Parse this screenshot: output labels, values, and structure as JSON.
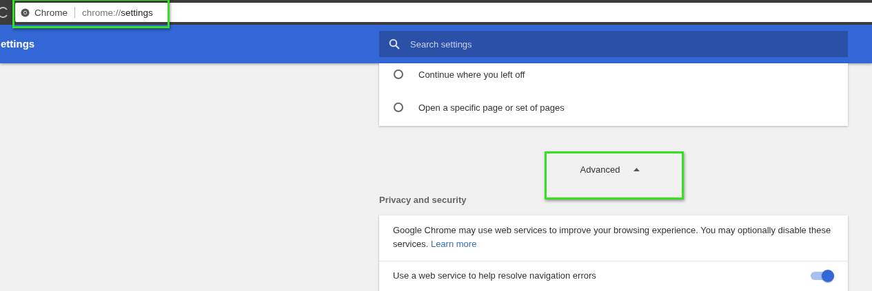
{
  "omnibox": {
    "highlighted": true,
    "site_label": "Chrome",
    "url_scheme": "chrome://",
    "url_path": "settings"
  },
  "header": {
    "title": "ettings",
    "search": {
      "placeholder": "Search settings"
    }
  },
  "on_startup": [
    {
      "label": "Continue where you left off",
      "selected": false
    },
    {
      "label": "Open a specific page or set of pages",
      "selected": false
    }
  ],
  "advanced": {
    "label": "Advanced",
    "expanded": true,
    "highlighted": true
  },
  "privacy": {
    "heading": "Privacy and security",
    "intro": "Google Chrome may use web services to improve your browsing experience. You may optionally disable these services.",
    "learn_more": "Learn more",
    "settings": [
      {
        "label": "Use a web service to help resolve navigation errors",
        "on": true
      }
    ]
  }
}
